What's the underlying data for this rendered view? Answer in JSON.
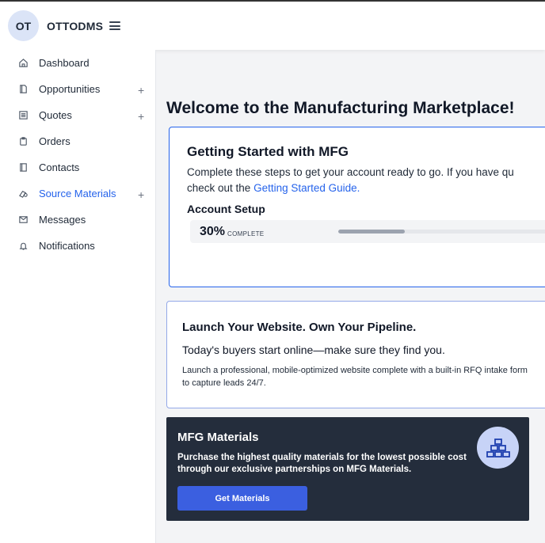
{
  "header": {
    "avatar_initials": "OT",
    "brand": "OTTODMS"
  },
  "sidebar": {
    "items": [
      {
        "label": "Dashboard",
        "icon": "home-icon"
      },
      {
        "label": "Opportunities",
        "icon": "document-icon",
        "expandable": true
      },
      {
        "label": "Quotes",
        "icon": "list-icon",
        "expandable": true
      },
      {
        "label": "Orders",
        "icon": "clipboard-icon"
      },
      {
        "label": "Contacts",
        "icon": "contacts-icon"
      },
      {
        "label": "Source Materials",
        "icon": "materials-icon",
        "expandable": true,
        "active": true
      },
      {
        "label": "Messages",
        "icon": "envelope-icon"
      },
      {
        "label": "Notifications",
        "icon": "bell-icon"
      }
    ],
    "plus_glyph": "+"
  },
  "main": {
    "title": "Welcome to the Manufacturing Marketplace!",
    "getting_started": {
      "title": "Getting Started with MFG",
      "text_line1": "Complete these steps to get your account ready to go. If you have qu",
      "text_line2_prefix": "check out the ",
      "link": "Getting Started Guide.",
      "subtitle": "Account Setup",
      "progress_percent": "30%",
      "progress_fraction": 0.3,
      "progress_label": "COMPLETE"
    },
    "website": {
      "title": "Launch Your Website. Own Your Pipeline.",
      "subtitle": "Today's buyers start online—make sure they find you.",
      "text": "Launch a professional, mobile-optimized website complete with a built-in RFQ intake form to capture leads 24/7."
    },
    "materials": {
      "title": "MFG Materials",
      "text": "Purchase the highest quality materials for the lowest possible cost through our exclusive partnerships on MFG Materials.",
      "button": "Get Materials",
      "icon": "bricks-icon"
    }
  },
  "colors": {
    "accent": "#2563eb",
    "dark_card": "#242d3c",
    "button": "#3b5fe0"
  }
}
